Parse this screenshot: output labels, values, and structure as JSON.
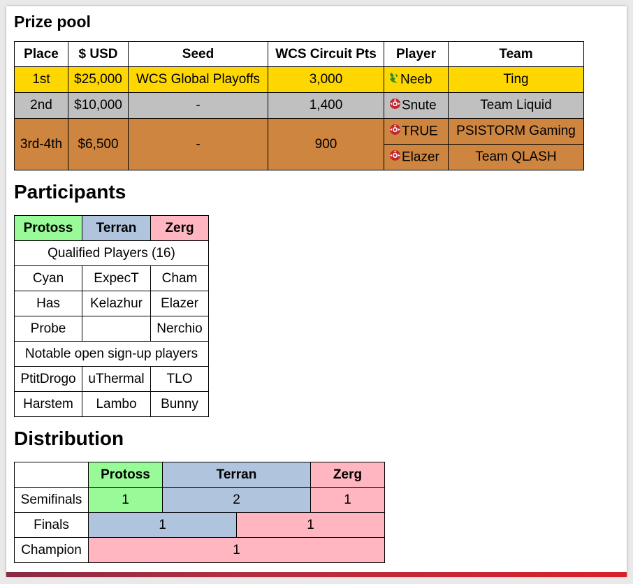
{
  "headings": {
    "prize_pool": "Prize pool",
    "participants": "Participants",
    "distribution": "Distribution"
  },
  "prize_pool": {
    "columns": [
      "Place",
      "$ USD",
      "Seed",
      "WCS Circuit Pts",
      "Player",
      "Team"
    ],
    "rows": [
      {
        "place": "1st",
        "usd": "$25,000",
        "seed": "WCS Global Playoffs",
        "pts": "3,000",
        "players": [
          {
            "race": "terran",
            "name": "Neeb",
            "team": "Ting"
          }
        ]
      },
      {
        "place": "2nd",
        "usd": "$10,000",
        "seed": "-",
        "pts": "1,400",
        "players": [
          {
            "race": "zerg",
            "name": "Snute",
            "team": "Team Liquid"
          }
        ]
      },
      {
        "place": "3rd-4th",
        "usd": "$6,500",
        "seed": "-",
        "pts": "900",
        "players": [
          {
            "race": "zerg",
            "name": "TRUE",
            "team": "PSISTORM Gaming"
          },
          {
            "race": "zerg",
            "name": "Elazer",
            "team": "Team QLASH"
          }
        ]
      }
    ]
  },
  "participants": {
    "races": [
      "Protoss",
      "Terran",
      "Zerg"
    ],
    "qualified_label": "Qualified Players (16)",
    "qualified": [
      [
        "Cyan",
        "ExpecT",
        "Cham"
      ],
      [
        "Has",
        "Kelazhur",
        "Elazer"
      ],
      [
        "Probe",
        "",
        "Nerchio"
      ]
    ],
    "open_label": "Notable open sign-up players",
    "open": [
      [
        "PtitDrogo",
        "uThermal",
        "TLO"
      ],
      [
        "Harstem",
        "Lambo",
        "Bunny"
      ]
    ]
  },
  "distribution": {
    "races": [
      "Protoss",
      "Terran",
      "Zerg"
    ],
    "rows": [
      {
        "label": "Semifinals",
        "cells": [
          "1",
          "2",
          "1"
        ]
      },
      {
        "label": "Finals",
        "cells": [
          "1",
          "1"
        ]
      },
      {
        "label": "Champion",
        "cells": [
          "1"
        ]
      }
    ]
  },
  "colors": {
    "gold": "#ffd700",
    "silver": "#c0c0c0",
    "bronze": "#cd853f",
    "protoss": "#98fb98",
    "terran": "#b0c4de",
    "zerg": "#ffb6c1"
  },
  "icons": {
    "terran": "terran-icon",
    "zerg": "zerg-icon"
  }
}
